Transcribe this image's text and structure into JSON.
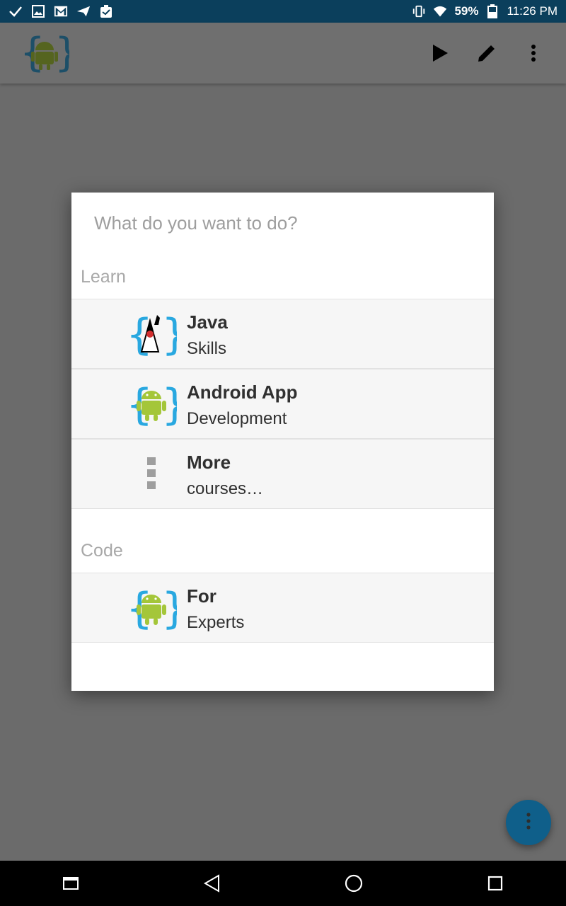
{
  "status_bar": {
    "battery": "59%",
    "time": "11:26 PM",
    "left_icons": [
      "check-icon",
      "image-icon",
      "gmail-icon",
      "send-icon",
      "clipboard-icon"
    ],
    "right_icons": [
      "vibrate-icon",
      "wifi-icon",
      "battery-icon"
    ]
  },
  "app_bar": {
    "logo": "android-code-logo",
    "actions": [
      "play-icon",
      "pencil-icon",
      "more-vert-icon"
    ]
  },
  "dialog": {
    "title": "What do you want to do?",
    "sections": [
      {
        "header": "Learn",
        "items": [
          {
            "title": "Java",
            "subtitle": "Skills",
            "icon": "java-duke-icon"
          },
          {
            "title": "Android App",
            "subtitle": "Development",
            "icon": "android-code-icon"
          },
          {
            "title": "More",
            "subtitle": "courses…",
            "icon": "more-dots-icon"
          }
        ]
      },
      {
        "header": "Code",
        "items": [
          {
            "title": "For",
            "subtitle": "Experts",
            "icon": "android-code-icon"
          }
        ]
      }
    ]
  },
  "fab": {
    "icon": "more-vert-icon"
  },
  "nav_bar": {
    "buttons": [
      "recents-icon",
      "back-icon",
      "home-icon",
      "overview-icon"
    ]
  },
  "colors": {
    "status_bar": "#0b3f5c",
    "scrim": "#6b6b6b",
    "fab": "#0f5f8a",
    "android_green": "#a4c639",
    "brace_blue": "#29a8e0"
  }
}
